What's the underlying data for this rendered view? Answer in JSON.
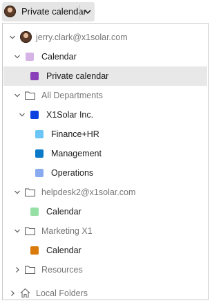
{
  "header": {
    "selected_calendar": "Private calendar"
  },
  "tree": {
    "account": "jerry.clark@x1solar.com",
    "account_calendar": {
      "label": "Calendar",
      "color": "#d6b4e6"
    },
    "private_calendar": {
      "label": "Private calendar",
      "color": "#8a40b8"
    },
    "all_departments": "All Departments",
    "x1solar": {
      "label": "X1Solar Inc.",
      "color": "#0a3fe0"
    },
    "finance_hr": {
      "label": "Finance+HR",
      "color": "#6cc6f5"
    },
    "management": {
      "label": "Management",
      "color": "#0a79c8"
    },
    "operations": {
      "label": "Operations",
      "color": "#8aaaf0"
    },
    "helpdesk": "helpdesk2@x1solar.com",
    "helpdesk_calendar": {
      "label": "Calendar",
      "color": "#96e0a6"
    },
    "marketing": "Marketing X1",
    "marketing_calendar": {
      "label": "Calendar",
      "color": "#d97a0a"
    },
    "resources": "Resources",
    "local_folders": "Local Folders"
  }
}
